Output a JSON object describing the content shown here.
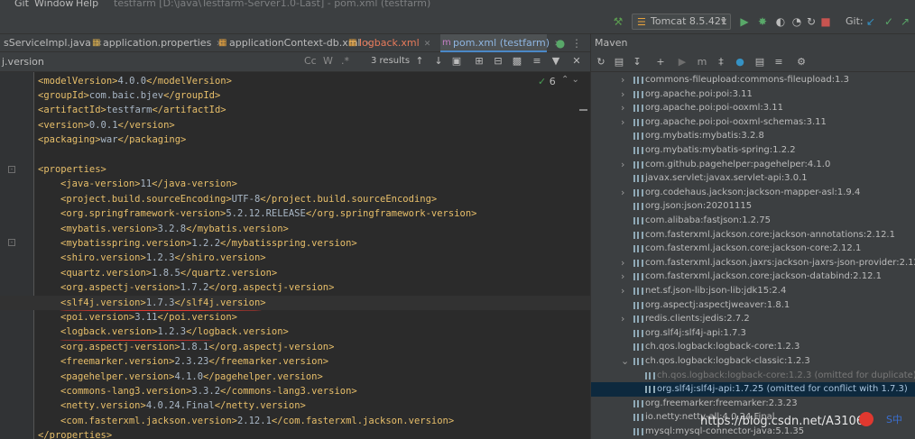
{
  "menu": {
    "items": [
      "Git",
      "Window",
      "Help"
    ],
    "title": "testfarm [D:\\java\\Testfarm-Server1.0-Last] - pom.xml (testfarm)"
  },
  "toolbar": {
    "run_config": "Tomcat 8.5.421",
    "git_label": "Git:"
  },
  "tabs": [
    {
      "label": "sServiceImpl.java",
      "icon": "java-class-icon",
      "color": "#bbbbbb"
    },
    {
      "label": "application.properties",
      "icon": "properties-file-icon",
      "color": "#bbbbbb"
    },
    {
      "label": "applicationContext-db.xml",
      "icon": "xml-file-icon",
      "color": "#bbbbbb"
    },
    {
      "label": "logback.xml",
      "icon": "xml-file-icon",
      "color": "#cc7832"
    },
    {
      "label": "pom.xml (testfarm)",
      "icon": "maven-icon",
      "color": "#6897bb"
    }
  ],
  "search": {
    "value": "j.version",
    "results": "3 results",
    "options": [
      "Cc",
      "W",
      ".*"
    ]
  },
  "editor": {
    "inspection_count": "6",
    "lines": [
      {
        "indent": 0,
        "tag_open": "<modelVersion>",
        "text": "4.0.0",
        "tag_close": "</modelVersion>"
      },
      {
        "indent": 0,
        "tag_open": "<groupId>",
        "text": "com.baic.bjev",
        "tag_close": "</groupId>"
      },
      {
        "indent": 0,
        "tag_open": "<artifactId>",
        "text": "testfarm",
        "tag_close": "</artifactId>"
      },
      {
        "indent": 0,
        "tag_open": "<version>",
        "text": "0.0.1",
        "tag_close": "</version>"
      },
      {
        "indent": 0,
        "tag_open": "<packaging>",
        "text": "war",
        "tag_close": "</packaging>"
      },
      {
        "indent": 0,
        "tag_open": "",
        "text": "",
        "tag_close": ""
      },
      {
        "indent": 0,
        "tag_open": "<properties>",
        "text": "",
        "tag_close": ""
      },
      {
        "indent": 1,
        "tag_open": "<java-version>",
        "text": "11",
        "tag_close": "</java-version>"
      },
      {
        "indent": 1,
        "tag_open": "<project.build.sourceEncoding>",
        "text": "UTF-8",
        "tag_close": "</project.build.sourceEncoding>"
      },
      {
        "indent": 1,
        "tag_open": "<org.springframework-version>",
        "text": "5.2.12.RELEASE",
        "tag_close": "</org.springframework-version>"
      },
      {
        "indent": 1,
        "tag_open": "<mybatis.version>",
        "text": "3.2.8",
        "tag_close": "</mybatis.version>"
      },
      {
        "indent": 1,
        "tag_open": "<mybatisspring.version>",
        "text": "1.2.2",
        "tag_close": "</mybatisspring.version>"
      },
      {
        "indent": 1,
        "tag_open": "<shiro.version>",
        "text": "1.2.3",
        "tag_close": "</shiro.version>"
      },
      {
        "indent": 1,
        "tag_open": "<quartz.version>",
        "text": "1.8.5",
        "tag_close": "</quartz.version>"
      },
      {
        "indent": 1,
        "tag_open": "<org.aspectj-version>",
        "text": "1.7.2",
        "tag_close": "</org.aspectj-version>"
      },
      {
        "indent": 1,
        "tag_open": "<slf4j.version>",
        "text": "1.7.3",
        "tag_close": "</slf4j.version>"
      },
      {
        "indent": 1,
        "tag_open": "<poi.version>",
        "text": "3.11",
        "tag_close": "</poi.version>"
      },
      {
        "indent": 1,
        "tag_open": "<logback.version>",
        "text": "1.2.3",
        "tag_close": "</logback.version>"
      },
      {
        "indent": 1,
        "tag_open": "<org.aspectj-version>",
        "text": "1.8.1",
        "tag_close": "</org.aspectj-version>"
      },
      {
        "indent": 1,
        "tag_open": "<freemarker.version>",
        "text": "2.3.23",
        "tag_close": "</freemarker.version>"
      },
      {
        "indent": 1,
        "tag_open": "<pagehelper.version>",
        "text": "4.1.0",
        "tag_close": "</pagehelper.version>"
      },
      {
        "indent": 1,
        "tag_open": "<commons-lang3.version>",
        "text": "3.3.2",
        "tag_close": "</commons-lang3.version>"
      },
      {
        "indent": 1,
        "tag_open": "<netty.version>",
        "text": "4.0.24.Final",
        "tag_close": "</netty.version>"
      },
      {
        "indent": 1,
        "tag_open": "<com.fasterxml.jackson.version>",
        "text": "2.12.1",
        "tag_close": "</com.fasterxml.jackson.version>"
      },
      {
        "indent": 0,
        "tag_open": "</properties>",
        "text": "",
        "tag_close": ""
      }
    ]
  },
  "maven": {
    "title": "Maven",
    "tree": [
      {
        "label": "commons-fileupload:commons-fileupload:1.3",
        "arrow": true,
        "level": 1
      },
      {
        "label": "org.apache.poi:poi:3.11",
        "arrow": true,
        "level": 1
      },
      {
        "label": "org.apache.poi:poi-ooxml:3.11",
        "arrow": true,
        "level": 1
      },
      {
        "label": "org.apache.poi:poi-ooxml-schemas:3.11",
        "arrow": true,
        "level": 1
      },
      {
        "label": "org.mybatis:mybatis:3.2.8",
        "arrow": false,
        "level": 1
      },
      {
        "label": "org.mybatis:mybatis-spring:1.2.2",
        "arrow": false,
        "level": 1
      },
      {
        "label": "com.github.pagehelper:pagehelper:4.1.0",
        "arrow": true,
        "level": 1
      },
      {
        "label": "javax.servlet:javax.servlet-api:3.0.1",
        "arrow": false,
        "level": 1
      },
      {
        "label": "org.codehaus.jackson:jackson-mapper-asl:1.9.4",
        "arrow": true,
        "level": 1
      },
      {
        "label": "org.json:json:20201115",
        "arrow": false,
        "level": 1
      },
      {
        "label": "com.alibaba:fastjson:1.2.75",
        "arrow": false,
        "level": 1
      },
      {
        "label": "com.fasterxml.jackson.core:jackson-annotations:2.12.1",
        "arrow": false,
        "level": 1
      },
      {
        "label": "com.fasterxml.jackson.core:jackson-core:2.12.1",
        "arrow": false,
        "level": 1
      },
      {
        "label": "com.fasterxml.jackson.jaxrs:jackson-jaxrs-json-provider:2.12.1",
        "arrow": true,
        "level": 1
      },
      {
        "label": "com.fasterxml.jackson.core:jackson-databind:2.12.1",
        "arrow": true,
        "level": 1
      },
      {
        "label": "net.sf.json-lib:json-lib:jdk15:2.4",
        "arrow": true,
        "level": 1
      },
      {
        "label": "org.aspectj:aspectjweaver:1.8.1",
        "arrow": false,
        "level": 1
      },
      {
        "label": "redis.clients:jedis:2.7.2",
        "arrow": true,
        "level": 1
      },
      {
        "label": "org.slf4j:slf4j-api:1.7.3",
        "arrow": false,
        "level": 1
      },
      {
        "label": "ch.qos.logback:logback-core:1.2.3",
        "arrow": false,
        "level": 1
      },
      {
        "label": "ch.qos.logback:logback-classic:1.2.3",
        "arrow": true,
        "level": 1,
        "expanded": true
      },
      {
        "label": "ch.qos.logback:logback-core:1.2.3 (omitted for duplicate)",
        "arrow": false,
        "level": 2,
        "omitted": true
      },
      {
        "label": "org.slf4j:slf4j-api:1.7.25 (omitted for conflict with 1.7.3)",
        "arrow": false,
        "level": 2,
        "selected": true
      },
      {
        "label": "org.freemarker:freemarker:2.3.23",
        "arrow": false,
        "level": 1
      },
      {
        "label": "io.netty:netty-all:4.0.24.Final",
        "arrow": false,
        "level": 1
      },
      {
        "label": "mysql:mysql-connector-java:5.1.35",
        "arrow": false,
        "level": 1
      }
    ]
  },
  "watermark": "https://blog.csdn.net/A3106",
  "logo_text": "S中",
  "colors": {
    "tag": "#e8bf6a",
    "text": "#a9b7c6",
    "annotation": "#e0382f",
    "accent": "#4a88c7"
  }
}
